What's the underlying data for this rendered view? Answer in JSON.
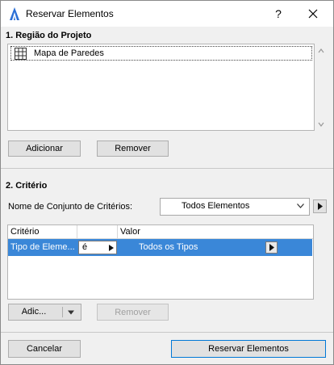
{
  "window": {
    "title": "Reservar Elementos",
    "help_label": "?"
  },
  "section1": {
    "title": "1. Região do Projeto",
    "items": [
      {
        "label": "Mapa de Paredes",
        "icon": "grid-icon"
      }
    ],
    "add_label": "Adicionar",
    "remove_label": "Remover"
  },
  "section2": {
    "title": "2. Critério",
    "criteria_set_label": "Nome de Conjunto de Critérios:",
    "criteria_set_value": "Todos Elementos",
    "table": {
      "headers": [
        "Critério",
        "",
        "Valor"
      ],
      "rows": [
        {
          "criterion": "Tipo de Eleme...",
          "operator": "é",
          "value": "Todos os Tipos",
          "selected": true
        }
      ]
    },
    "add_label": "Adic...",
    "remove_label": "Remover"
  },
  "footer": {
    "cancel_label": "Cancelar",
    "confirm_label": "Reservar Elementos"
  },
  "colors": {
    "selection": "#3a87d8",
    "primary_border": "#0078d7"
  }
}
